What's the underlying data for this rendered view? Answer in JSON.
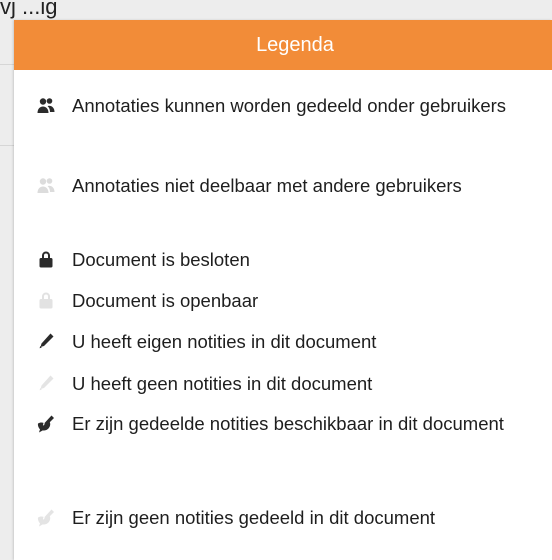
{
  "background": {
    "partial_text": "vj ...ig"
  },
  "legend": {
    "title": "Legenda",
    "header_color": "#f28c38",
    "items": [
      {
        "icon": "users-icon",
        "state": "active",
        "label": "Annotaties kunnen worden gedeeld onder gebruikers"
      },
      {
        "icon": "users-icon",
        "state": "inactive",
        "label": "Annotaties niet deelbaar met andere gebruikers"
      },
      {
        "icon": "lock-icon",
        "state": "active",
        "label": "Document is besloten"
      },
      {
        "icon": "lock-icon",
        "state": "inactive",
        "label": "Document is openbaar"
      },
      {
        "icon": "pencil-icon",
        "state": "active",
        "label": "U heeft eigen notities in dit document"
      },
      {
        "icon": "pencil-icon",
        "state": "inactive",
        "label": "U heeft geen notities in dit document"
      },
      {
        "icon": "shared-pencil-icon",
        "state": "active",
        "label": "Er zijn gedeelde notities beschikbaar in dit document"
      },
      {
        "icon": "shared-pencil-icon",
        "state": "inactive",
        "label": "Er zijn geen notities gedeeld in dit document"
      }
    ]
  }
}
